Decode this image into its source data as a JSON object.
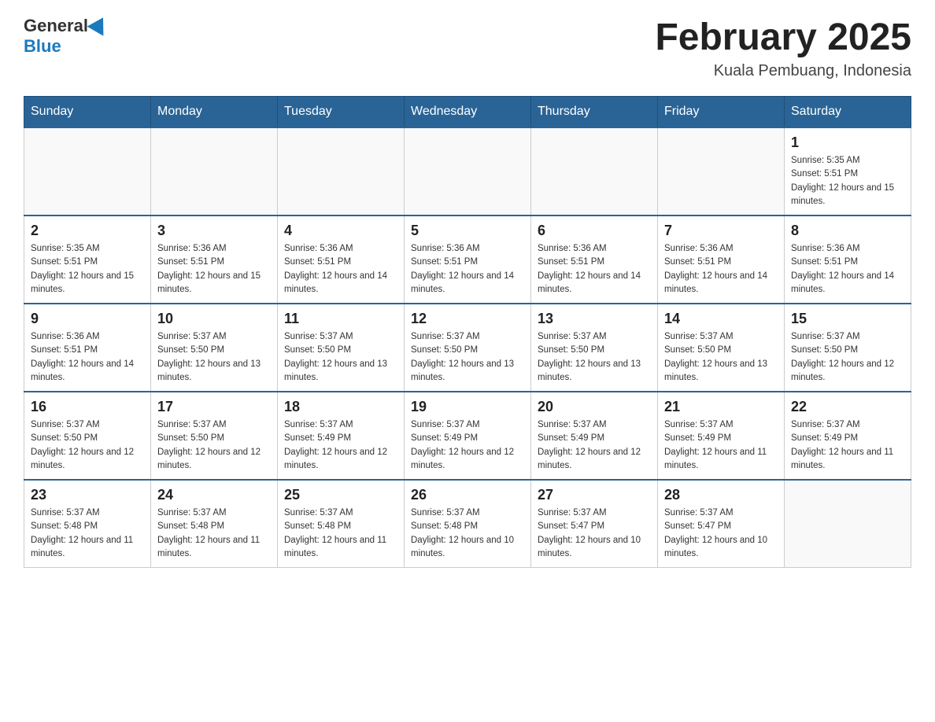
{
  "header": {
    "logo_general": "General",
    "logo_blue": "Blue",
    "month_title": "February 2025",
    "location": "Kuala Pembuang, Indonesia"
  },
  "weekdays": [
    "Sunday",
    "Monday",
    "Tuesday",
    "Wednesday",
    "Thursday",
    "Friday",
    "Saturday"
  ],
  "weeks": [
    [
      {
        "day": "",
        "sunrise": "",
        "sunset": "",
        "daylight": ""
      },
      {
        "day": "",
        "sunrise": "",
        "sunset": "",
        "daylight": ""
      },
      {
        "day": "",
        "sunrise": "",
        "sunset": "",
        "daylight": ""
      },
      {
        "day": "",
        "sunrise": "",
        "sunset": "",
        "daylight": ""
      },
      {
        "day": "",
        "sunrise": "",
        "sunset": "",
        "daylight": ""
      },
      {
        "day": "",
        "sunrise": "",
        "sunset": "",
        "daylight": ""
      },
      {
        "day": "1",
        "sunrise": "Sunrise: 5:35 AM",
        "sunset": "Sunset: 5:51 PM",
        "daylight": "Daylight: 12 hours and 15 minutes."
      }
    ],
    [
      {
        "day": "2",
        "sunrise": "Sunrise: 5:35 AM",
        "sunset": "Sunset: 5:51 PM",
        "daylight": "Daylight: 12 hours and 15 minutes."
      },
      {
        "day": "3",
        "sunrise": "Sunrise: 5:36 AM",
        "sunset": "Sunset: 5:51 PM",
        "daylight": "Daylight: 12 hours and 15 minutes."
      },
      {
        "day": "4",
        "sunrise": "Sunrise: 5:36 AM",
        "sunset": "Sunset: 5:51 PM",
        "daylight": "Daylight: 12 hours and 14 minutes."
      },
      {
        "day": "5",
        "sunrise": "Sunrise: 5:36 AM",
        "sunset": "Sunset: 5:51 PM",
        "daylight": "Daylight: 12 hours and 14 minutes."
      },
      {
        "day": "6",
        "sunrise": "Sunrise: 5:36 AM",
        "sunset": "Sunset: 5:51 PM",
        "daylight": "Daylight: 12 hours and 14 minutes."
      },
      {
        "day": "7",
        "sunrise": "Sunrise: 5:36 AM",
        "sunset": "Sunset: 5:51 PM",
        "daylight": "Daylight: 12 hours and 14 minutes."
      },
      {
        "day": "8",
        "sunrise": "Sunrise: 5:36 AM",
        "sunset": "Sunset: 5:51 PM",
        "daylight": "Daylight: 12 hours and 14 minutes."
      }
    ],
    [
      {
        "day": "9",
        "sunrise": "Sunrise: 5:36 AM",
        "sunset": "Sunset: 5:51 PM",
        "daylight": "Daylight: 12 hours and 14 minutes."
      },
      {
        "day": "10",
        "sunrise": "Sunrise: 5:37 AM",
        "sunset": "Sunset: 5:50 PM",
        "daylight": "Daylight: 12 hours and 13 minutes."
      },
      {
        "day": "11",
        "sunrise": "Sunrise: 5:37 AM",
        "sunset": "Sunset: 5:50 PM",
        "daylight": "Daylight: 12 hours and 13 minutes."
      },
      {
        "day": "12",
        "sunrise": "Sunrise: 5:37 AM",
        "sunset": "Sunset: 5:50 PM",
        "daylight": "Daylight: 12 hours and 13 minutes."
      },
      {
        "day": "13",
        "sunrise": "Sunrise: 5:37 AM",
        "sunset": "Sunset: 5:50 PM",
        "daylight": "Daylight: 12 hours and 13 minutes."
      },
      {
        "day": "14",
        "sunrise": "Sunrise: 5:37 AM",
        "sunset": "Sunset: 5:50 PM",
        "daylight": "Daylight: 12 hours and 13 minutes."
      },
      {
        "day": "15",
        "sunrise": "Sunrise: 5:37 AM",
        "sunset": "Sunset: 5:50 PM",
        "daylight": "Daylight: 12 hours and 12 minutes."
      }
    ],
    [
      {
        "day": "16",
        "sunrise": "Sunrise: 5:37 AM",
        "sunset": "Sunset: 5:50 PM",
        "daylight": "Daylight: 12 hours and 12 minutes."
      },
      {
        "day": "17",
        "sunrise": "Sunrise: 5:37 AM",
        "sunset": "Sunset: 5:50 PM",
        "daylight": "Daylight: 12 hours and 12 minutes."
      },
      {
        "day": "18",
        "sunrise": "Sunrise: 5:37 AM",
        "sunset": "Sunset: 5:49 PM",
        "daylight": "Daylight: 12 hours and 12 minutes."
      },
      {
        "day": "19",
        "sunrise": "Sunrise: 5:37 AM",
        "sunset": "Sunset: 5:49 PM",
        "daylight": "Daylight: 12 hours and 12 minutes."
      },
      {
        "day": "20",
        "sunrise": "Sunrise: 5:37 AM",
        "sunset": "Sunset: 5:49 PM",
        "daylight": "Daylight: 12 hours and 12 minutes."
      },
      {
        "day": "21",
        "sunrise": "Sunrise: 5:37 AM",
        "sunset": "Sunset: 5:49 PM",
        "daylight": "Daylight: 12 hours and 11 minutes."
      },
      {
        "day": "22",
        "sunrise": "Sunrise: 5:37 AM",
        "sunset": "Sunset: 5:49 PM",
        "daylight": "Daylight: 12 hours and 11 minutes."
      }
    ],
    [
      {
        "day": "23",
        "sunrise": "Sunrise: 5:37 AM",
        "sunset": "Sunset: 5:48 PM",
        "daylight": "Daylight: 12 hours and 11 minutes."
      },
      {
        "day": "24",
        "sunrise": "Sunrise: 5:37 AM",
        "sunset": "Sunset: 5:48 PM",
        "daylight": "Daylight: 12 hours and 11 minutes."
      },
      {
        "day": "25",
        "sunrise": "Sunrise: 5:37 AM",
        "sunset": "Sunset: 5:48 PM",
        "daylight": "Daylight: 12 hours and 11 minutes."
      },
      {
        "day": "26",
        "sunrise": "Sunrise: 5:37 AM",
        "sunset": "Sunset: 5:48 PM",
        "daylight": "Daylight: 12 hours and 10 minutes."
      },
      {
        "day": "27",
        "sunrise": "Sunrise: 5:37 AM",
        "sunset": "Sunset: 5:47 PM",
        "daylight": "Daylight: 12 hours and 10 minutes."
      },
      {
        "day": "28",
        "sunrise": "Sunrise: 5:37 AM",
        "sunset": "Sunset: 5:47 PM",
        "daylight": "Daylight: 12 hours and 10 minutes."
      },
      {
        "day": "",
        "sunrise": "",
        "sunset": "",
        "daylight": ""
      }
    ]
  ]
}
